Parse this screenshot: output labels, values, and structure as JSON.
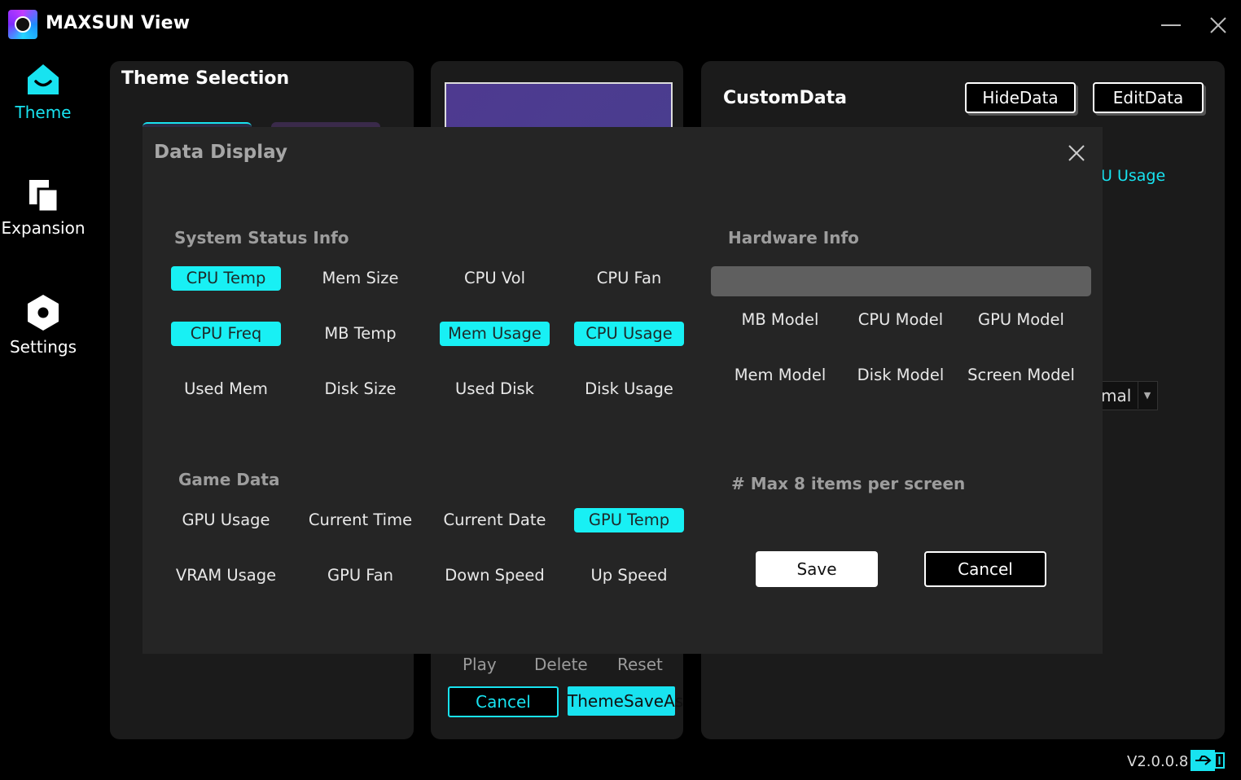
{
  "app": {
    "title": "MAXSUN View",
    "version": "V2.0.0.8"
  },
  "sidebar": {
    "items": [
      {
        "label": "Theme",
        "icon": "home-icon",
        "active": true
      },
      {
        "label": "Expansion",
        "icon": "copy-icon"
      },
      {
        "label": "Settings",
        "icon": "settings-hex-icon"
      }
    ]
  },
  "theme_panel": {
    "title": "Theme Selection"
  },
  "center_panel": {
    "actions": [
      "Play",
      "Delete",
      "Reset"
    ],
    "cancel_label": "Cancel",
    "save_as_label": "ThemeSaveAs"
  },
  "custom_panel": {
    "title": "CustomData",
    "hide_label": "HideData",
    "edit_label": "EditData",
    "partial_item": "U Usage",
    "dropdown_partial": "mal"
  },
  "modal": {
    "title": "Data Display",
    "system_section": "System Status Info",
    "hardware_section": "Hardware Info",
    "game_section": "Game Data",
    "system_items": [
      {
        "label": "CPU Temp",
        "on": true
      },
      {
        "label": "Mem Size",
        "on": false
      },
      {
        "label": "CPU Vol",
        "on": false
      },
      {
        "label": "CPU Fan",
        "on": false
      },
      {
        "label": "CPU Freq",
        "on": true
      },
      {
        "label": "MB Temp",
        "on": false
      },
      {
        "label": "Mem Usage",
        "on": true
      },
      {
        "label": "CPU Usage",
        "on": true
      },
      {
        "label": "Used Mem",
        "on": false
      },
      {
        "label": "Disk Size",
        "on": false
      },
      {
        "label": "Used Disk",
        "on": false
      },
      {
        "label": "Disk Usage",
        "on": false
      }
    ],
    "hardware_items": [
      {
        "label": "MB Model"
      },
      {
        "label": "CPU Model"
      },
      {
        "label": "GPU Model"
      },
      {
        "label": "Mem Model"
      },
      {
        "label": "Disk Model"
      },
      {
        "label": "Screen Model"
      }
    ],
    "game_items": [
      {
        "label": "GPU Usage",
        "on": false
      },
      {
        "label": "Current Time",
        "on": false
      },
      {
        "label": "Current Date",
        "on": false
      },
      {
        "label": "GPU Temp",
        "on": true
      },
      {
        "label": "VRAM Usage",
        "on": false
      },
      {
        "label": "GPU Fan",
        "on": false
      },
      {
        "label": "Down Speed",
        "on": false
      },
      {
        "label": "Up Speed",
        "on": false
      }
    ],
    "note": "# Max 8 items per screen",
    "save_label": "Save",
    "cancel_label": "Cancel"
  },
  "colors": {
    "accent": "#18f0f4",
    "panel": "#1b1b1b",
    "modal": "#252525"
  }
}
